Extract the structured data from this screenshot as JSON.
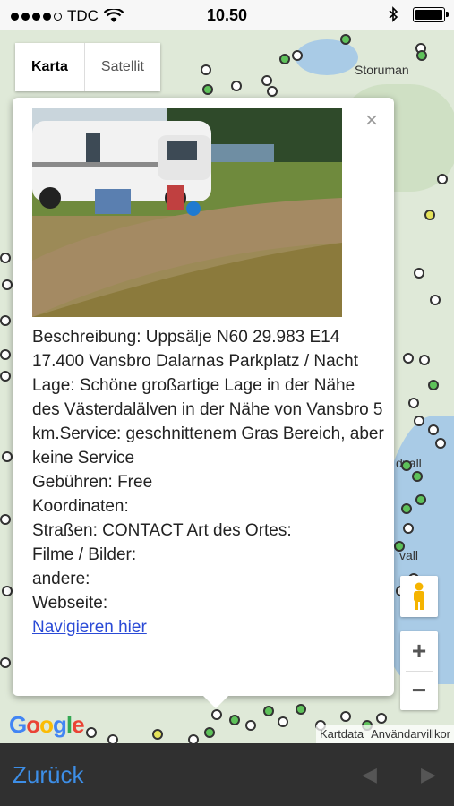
{
  "status": {
    "carrier": "TDC",
    "time": "10.50"
  },
  "map": {
    "tabs": [
      {
        "label": "Karta",
        "active": true
      },
      {
        "label": "Satellit",
        "active": false
      }
    ],
    "label_storuman": "Storuman",
    "label_dvall": "dvall",
    "label_vall": "vall",
    "google": "Google",
    "attribution": [
      "Kartdata",
      "Användarvillkor"
    ],
    "zoom_in": "+",
    "zoom_out": "−",
    "colors": {
      "water": "#a9cbe6",
      "land": "#dfe9d8",
      "pin_green": "#5ec25a",
      "pin_yellow": "#e5e35a"
    }
  },
  "info": {
    "close": "×",
    "lines": [
      "Beschreibung: Uppsälje N60 29.983 E14 17.400 Vansbro Dalarnas Parkplatz / Nacht",
      "Lage: Schöne großartige Lage in der Nähe des Västerdalälven in der Nähe von Vansbro 5 km.Service: geschnittenem Gras Bereich, aber keine Service",
      "Gebühren: Free",
      "Koordinaten:",
      "Straßen: CONTACT Art des Ortes:",
      "Filme / Bilder:",
      "andere:",
      "Webseite:"
    ],
    "link": "Navigieren hier"
  },
  "bottom": {
    "back": "Zurück",
    "prev": "◀",
    "next": "▶"
  }
}
